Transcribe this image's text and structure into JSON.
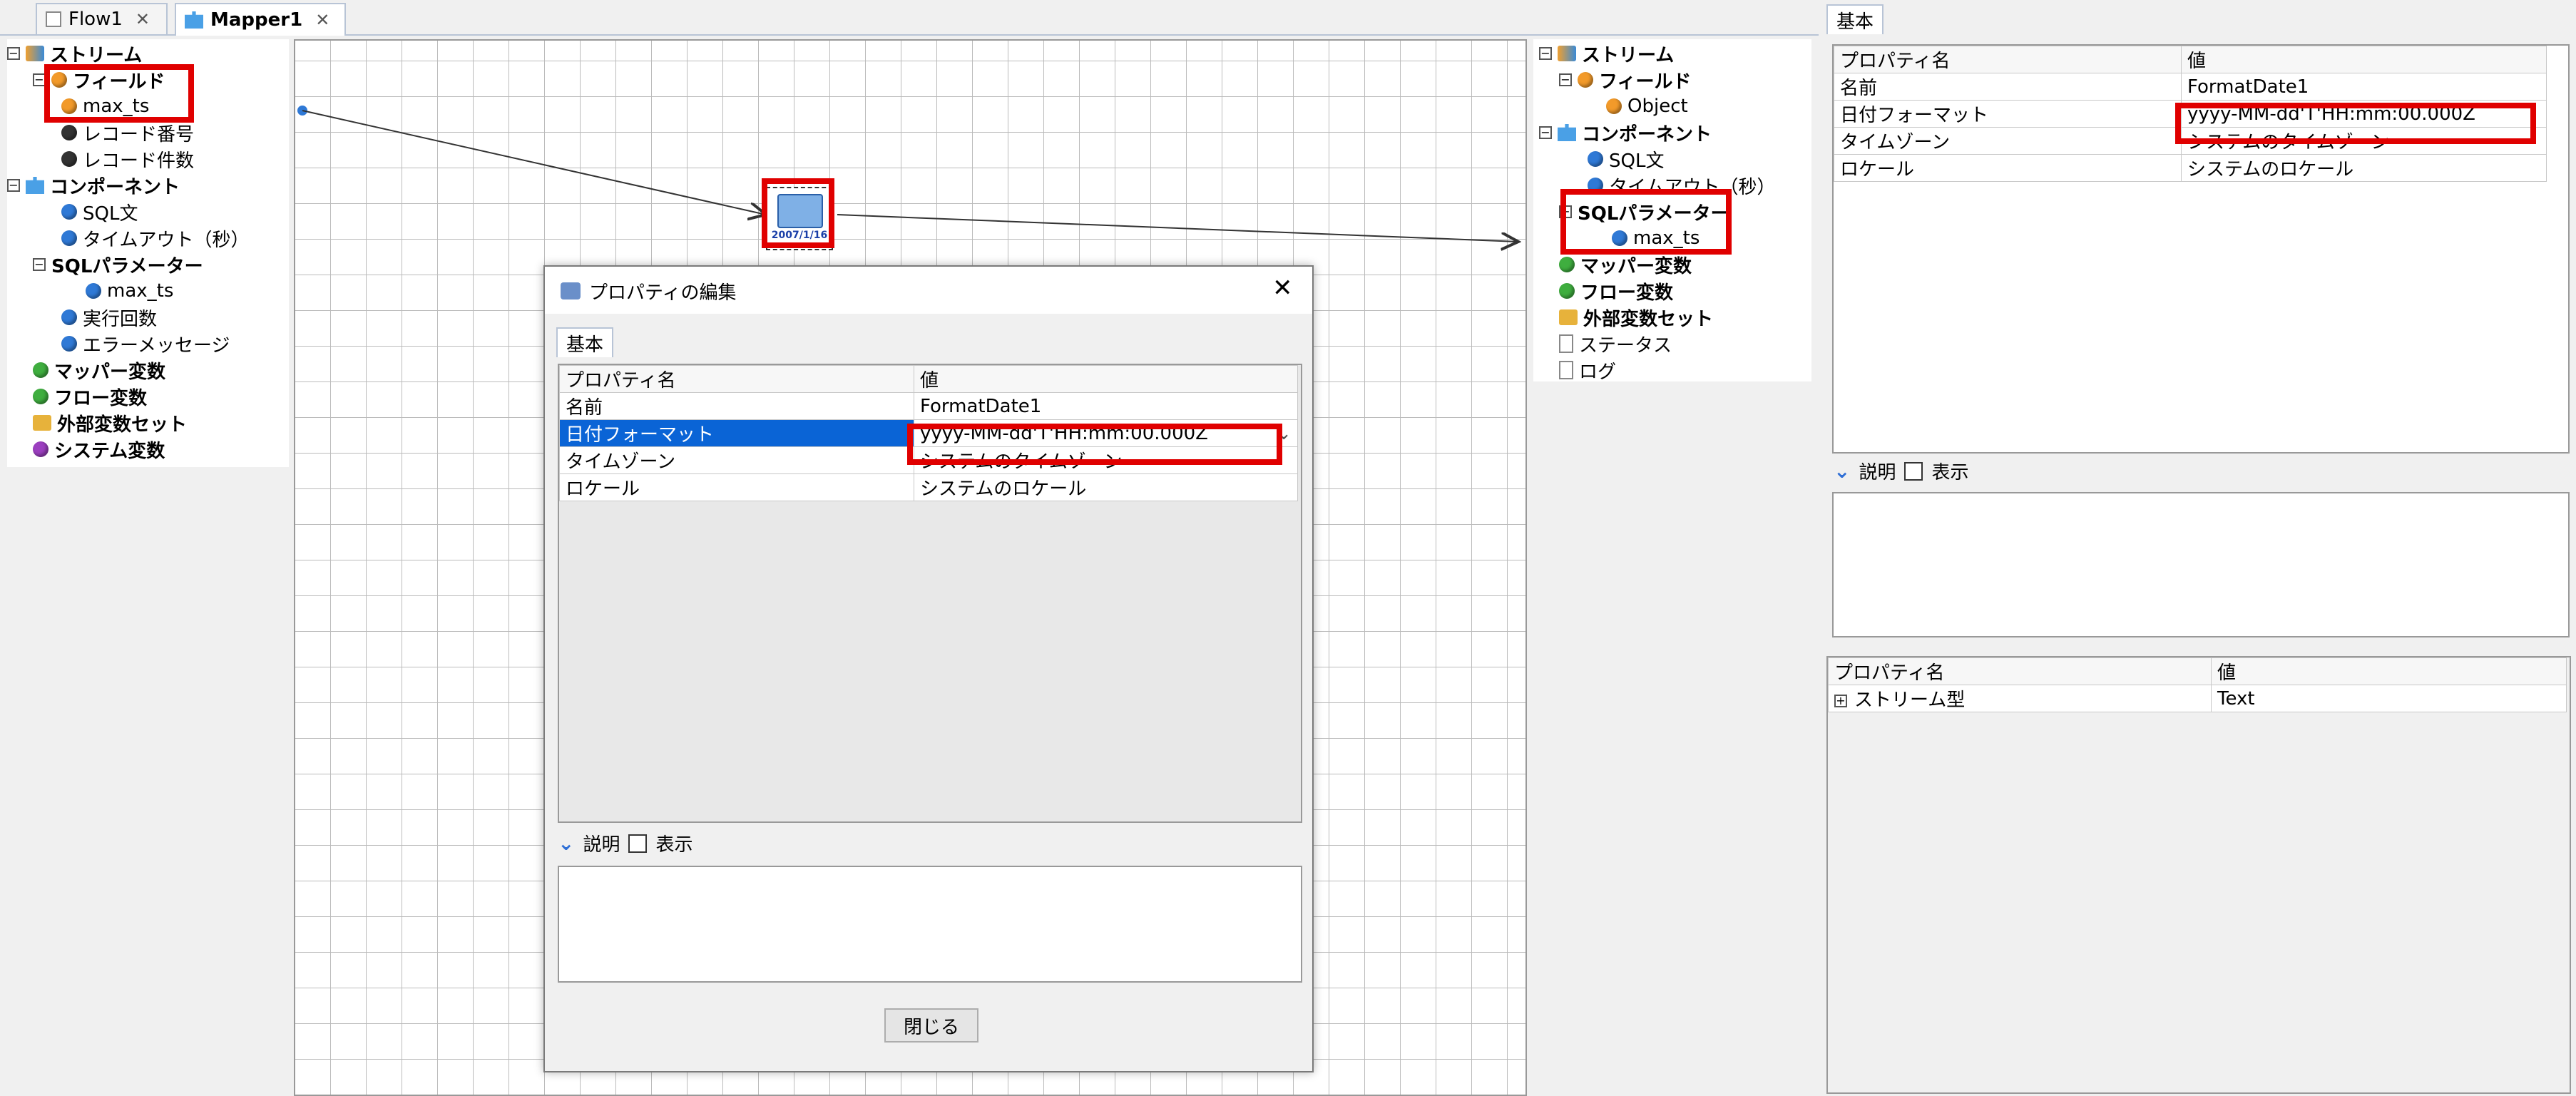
{
  "tabs": [
    {
      "label": "Flow1",
      "close": "✕"
    },
    {
      "label": "Mapper1",
      "close": "✕"
    }
  ],
  "left_tree": {
    "stream": "ストリーム",
    "field": "フィールド",
    "max_ts": "max_ts",
    "record_no": "レコード番号",
    "record_count": "レコード件数",
    "component": "コンポーネント",
    "sql": "SQL文",
    "timeout": "タイムアウト（秒）",
    "sql_params": "SQLパラメーター",
    "param_max_ts": "max_ts",
    "exec_count": "実行回数",
    "error_msg": "エラーメッセージ",
    "mapper_var": "マッパー変数",
    "flow_var": "フロー変数",
    "ext_var_set": "外部変数セット",
    "sys_var": "システム変数"
  },
  "canvas": {
    "node_label": "2007/1/16"
  },
  "right_tree": {
    "stream": "ストリーム",
    "field": "フィールド",
    "object": "Object",
    "component": "コンポーネント",
    "sql": "SQL文",
    "timeout": "タイムアウト（秒）",
    "sql_params": "SQLパラメーター",
    "param_max_ts": "max_ts",
    "mapper_var": "マッパー変数",
    "flow_var": "フロー変数",
    "ext_var_set": "外部変数セット",
    "status": "ステータス",
    "log": "ログ"
  },
  "dialog": {
    "title": "プロパティの編集",
    "close_icon": "✕",
    "tab": "基本",
    "col_name": "プロパティ名",
    "col_value": "値",
    "rows": [
      {
        "name": "名前",
        "value": "FormatDate1"
      },
      {
        "name": "日付フォーマット",
        "value": "yyyy-MM-dd'T'HH:mm:00.000Z"
      },
      {
        "name": "タイムゾーン",
        "value": "システムのタイムゾーン"
      },
      {
        "name": "ロケール",
        "value": "システムのロケール"
      }
    ],
    "desc_label": "説明",
    "show_label": "表示",
    "close_button": "閉じる"
  },
  "right_props": {
    "tab": "基本",
    "col_name": "プロパティ名",
    "col_value": "値",
    "rows": [
      {
        "name": "名前",
        "value": "FormatDate1"
      },
      {
        "name": "日付フォーマット",
        "value": "yyyy-MM-dd'T'HH:mm:00.000Z"
      },
      {
        "name": "タイムゾーン",
        "value": "システムのタイムゾーン"
      },
      {
        "name": "ロケール",
        "value": "システムのロケール"
      }
    ],
    "desc_label": "説明",
    "show_label": "表示"
  },
  "stream_props": {
    "col_name": "プロパティ名",
    "col_value": "値",
    "row_name": "ストリーム型",
    "row_value": "Text"
  },
  "colors": {
    "highlight": "#e00000",
    "selection": "#0a64d6"
  }
}
